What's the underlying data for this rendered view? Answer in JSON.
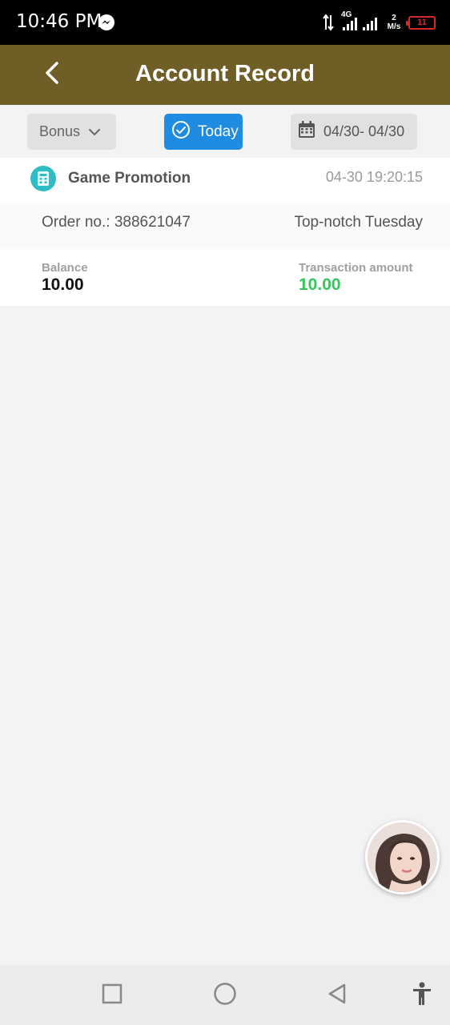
{
  "status_bar": {
    "time": "10:46 PM",
    "network": "4G",
    "speed_value": "2",
    "speed_unit": "M/s",
    "battery": "11"
  },
  "header": {
    "title": "Account Record",
    "back_icon": "chevron-left-icon"
  },
  "filters": {
    "type_label": "Bonus",
    "today_label": "Today",
    "date_range": "04/30- 04/30"
  },
  "records": [
    {
      "type": "Game Promotion",
      "time": "04-30 19:20:15",
      "order_no": "Order no.: 388621047",
      "remark": "Top-notch Tuesday",
      "balance_label": "Balance",
      "balance": "10.00",
      "amount_label": "Transaction amount",
      "amount": "10.00"
    }
  ],
  "colors": {
    "header_bg": "#6f5f27",
    "accent_blue": "#1f8be1",
    "amount_green": "#34c65b",
    "record_icon": "#2ebcc5"
  },
  "nav": {
    "icons": [
      "square-icon",
      "circle-icon",
      "triangle-back-icon",
      "accessibility-icon"
    ]
  }
}
